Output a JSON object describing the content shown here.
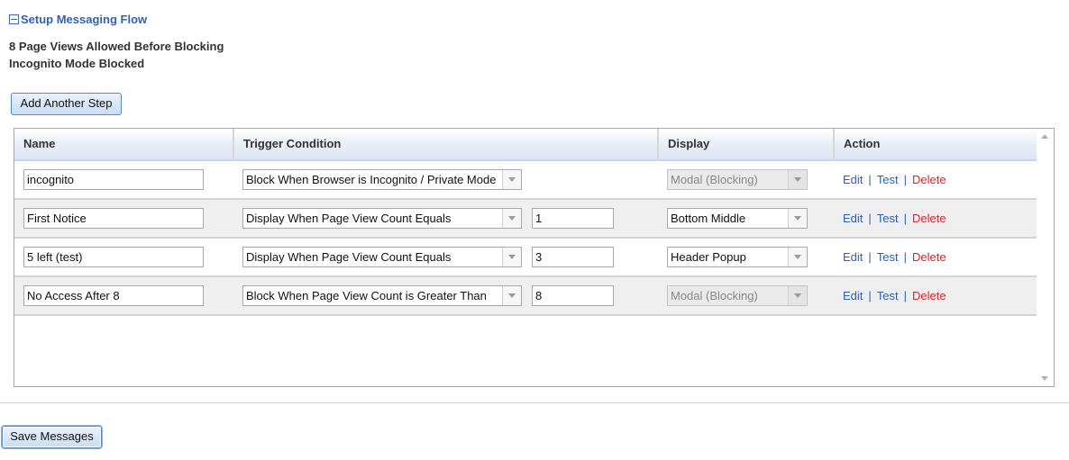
{
  "section": {
    "title": "Setup Messaging Flow"
  },
  "summary": {
    "page_views": "8 Page Views Allowed Before Blocking",
    "incognito": "Incognito Mode Blocked"
  },
  "buttons": {
    "add_step": "Add Another Step",
    "save": "Save Messages"
  },
  "grid": {
    "columns": {
      "name": "Name",
      "trigger": "Trigger Condition",
      "display": "Display",
      "action": "Action"
    },
    "rows": [
      {
        "name": "incognito",
        "trigger": "Block When Browser is Incognito / Private Mode",
        "count": "",
        "display": "Modal (Blocking)",
        "display_disabled": true
      },
      {
        "name": "First Notice",
        "trigger": "Display When Page View Count Equals",
        "count": "1",
        "display": "Bottom Middle",
        "display_disabled": false
      },
      {
        "name": "5 left (test)",
        "trigger": "Display When Page View Count Equals",
        "count": "3",
        "display": "Header Popup",
        "display_disabled": false
      },
      {
        "name": "No Access After 8",
        "trigger": "Block When Page View Count is Greater Than",
        "count": "8",
        "display": "Modal (Blocking)",
        "display_disabled": true
      }
    ],
    "actions": {
      "edit": "Edit",
      "test": "Test",
      "delete": "Delete",
      "separator": "|"
    }
  },
  "colors": {
    "link": "#2f62b0",
    "delete": "#d9232a",
    "header_bg": "#e9eef7"
  }
}
